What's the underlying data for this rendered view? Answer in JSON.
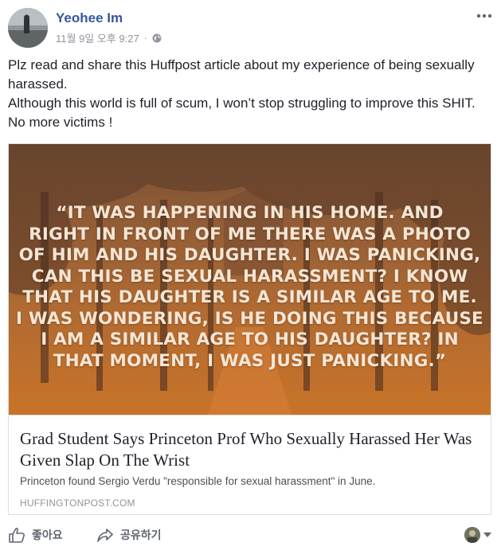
{
  "post": {
    "author": "Yeohee Im",
    "date": "11월 9일 오후 9:27",
    "separator": "·",
    "privacy_icon": "globe-icon",
    "text_lines": [
      "Plz read and share this Huffpost article about my experience of being sexually",
      "harassed.",
      "Although this world is full of scum, I won’t stop struggling to improve this SHIT.",
      "No more victims !"
    ]
  },
  "card": {
    "quote_lines": [
      "“It was happening in his home. And",
      "right in front of me there was a photo",
      "of him and his daughter. I was panicking,",
      "can this be sexual harassment? I know",
      "that his daughter is a similar age to me.",
      "I was wondering, is he doing this because",
      "I am a similar age to his daughter? In",
      "that moment, I was just panicking.”"
    ],
    "title": "Grad Student Says Princeton Prof Who Sexually Harassed Her Was Given Slap On The Wrist",
    "description": "Princeton found Sergio Verdu \"responsible for sexual harassment\" in June.",
    "domain": "HUFFINGTONPOST.COM"
  },
  "actions": {
    "like_label": "좋아요",
    "share_label": "공유하기"
  },
  "colors": {
    "author_link": "#365899",
    "meta_gray": "#90949c",
    "image_tint": "#c97328"
  }
}
